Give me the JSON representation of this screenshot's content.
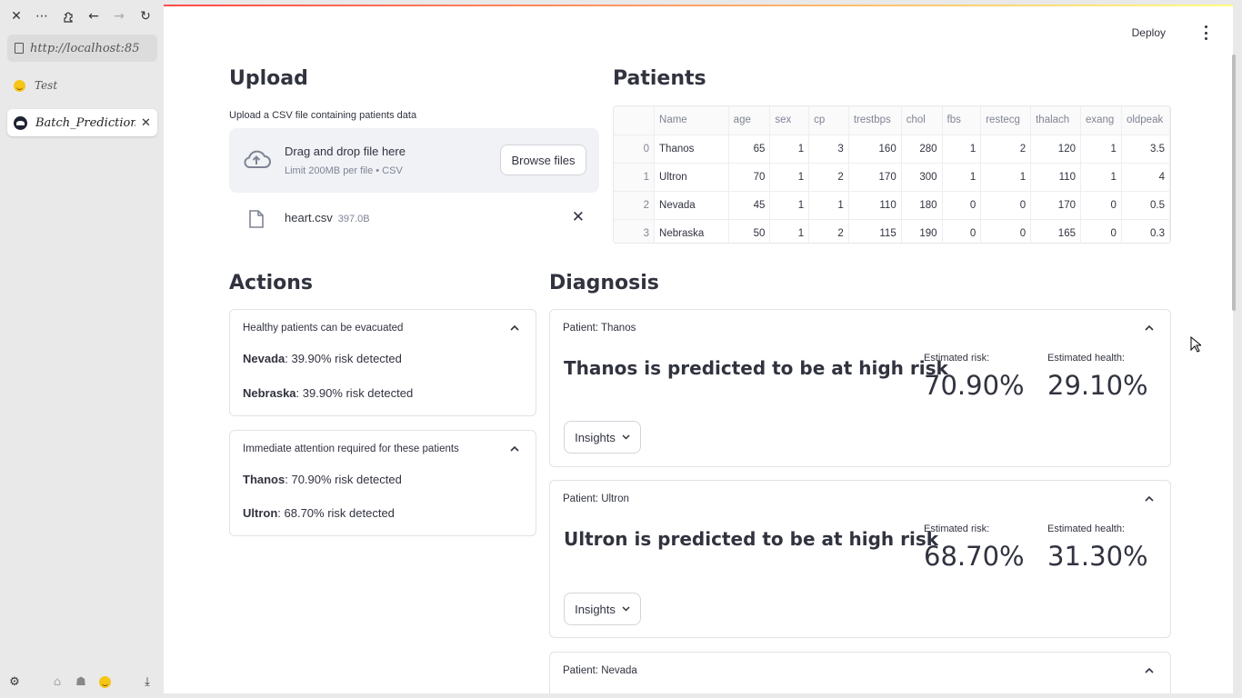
{
  "browser": {
    "url": "http://localhost:85",
    "bookmark": "Test",
    "tab_title": "Batch_Prediction"
  },
  "header": {
    "deploy": "Deploy"
  },
  "upload": {
    "heading": "Upload",
    "label": "Upload a CSV file containing patients data",
    "drop_title": "Drag and drop file here",
    "drop_sub": "Limit 200MB per file • CSV",
    "browse": "Browse files",
    "file_name": "heart.csv",
    "file_size": "397.0B"
  },
  "patients": {
    "heading": "Patients",
    "columns": [
      "",
      "Name",
      "age",
      "sex",
      "cp",
      "trestbps",
      "chol",
      "fbs",
      "restecg",
      "thalach",
      "exang",
      "oldpeak"
    ],
    "rows": [
      [
        "0",
        "Thanos",
        "65",
        "1",
        "3",
        "160",
        "280",
        "1",
        "2",
        "120",
        "1",
        "3.5"
      ],
      [
        "1",
        "Ultron",
        "70",
        "1",
        "2",
        "170",
        "300",
        "1",
        "1",
        "110",
        "1",
        "4"
      ],
      [
        "2",
        "Nevada",
        "45",
        "1",
        "1",
        "110",
        "180",
        "0",
        "0",
        "170",
        "0",
        "0.5"
      ],
      [
        "3",
        "Nebraska",
        "50",
        "1",
        "2",
        "115",
        "190",
        "0",
        "0",
        "165",
        "0",
        "0.3"
      ]
    ]
  },
  "actions": {
    "heading": "Actions",
    "healthy": {
      "title": "Healthy patients can be evacuated",
      "items": [
        {
          "name": "Nevada",
          "text": ": 39.90% risk detected"
        },
        {
          "name": "Nebraska",
          "text": ": 39.90% risk detected"
        }
      ]
    },
    "immediate": {
      "title": "Immediate attention required for these patients",
      "items": [
        {
          "name": "Thanos",
          "text": ": 70.90% risk detected"
        },
        {
          "name": "Ultron",
          "text": ": 68.70% risk detected"
        }
      ]
    }
  },
  "diagnosis": {
    "heading": "Diagnosis",
    "risk_label": "Estimated risk:",
    "health_label": "Estimated health:",
    "insights": "Insights",
    "patients": [
      {
        "header": "Patient: Thanos",
        "title": "Thanos is predicted to be at high risk",
        "risk": "70.90%",
        "health": "29.10%"
      },
      {
        "header": "Patient: Ultron",
        "title": "Ultron is predicted to be at high risk",
        "risk": "68.70%",
        "health": "31.30%"
      },
      {
        "header": "Patient: Nevada"
      }
    ]
  }
}
